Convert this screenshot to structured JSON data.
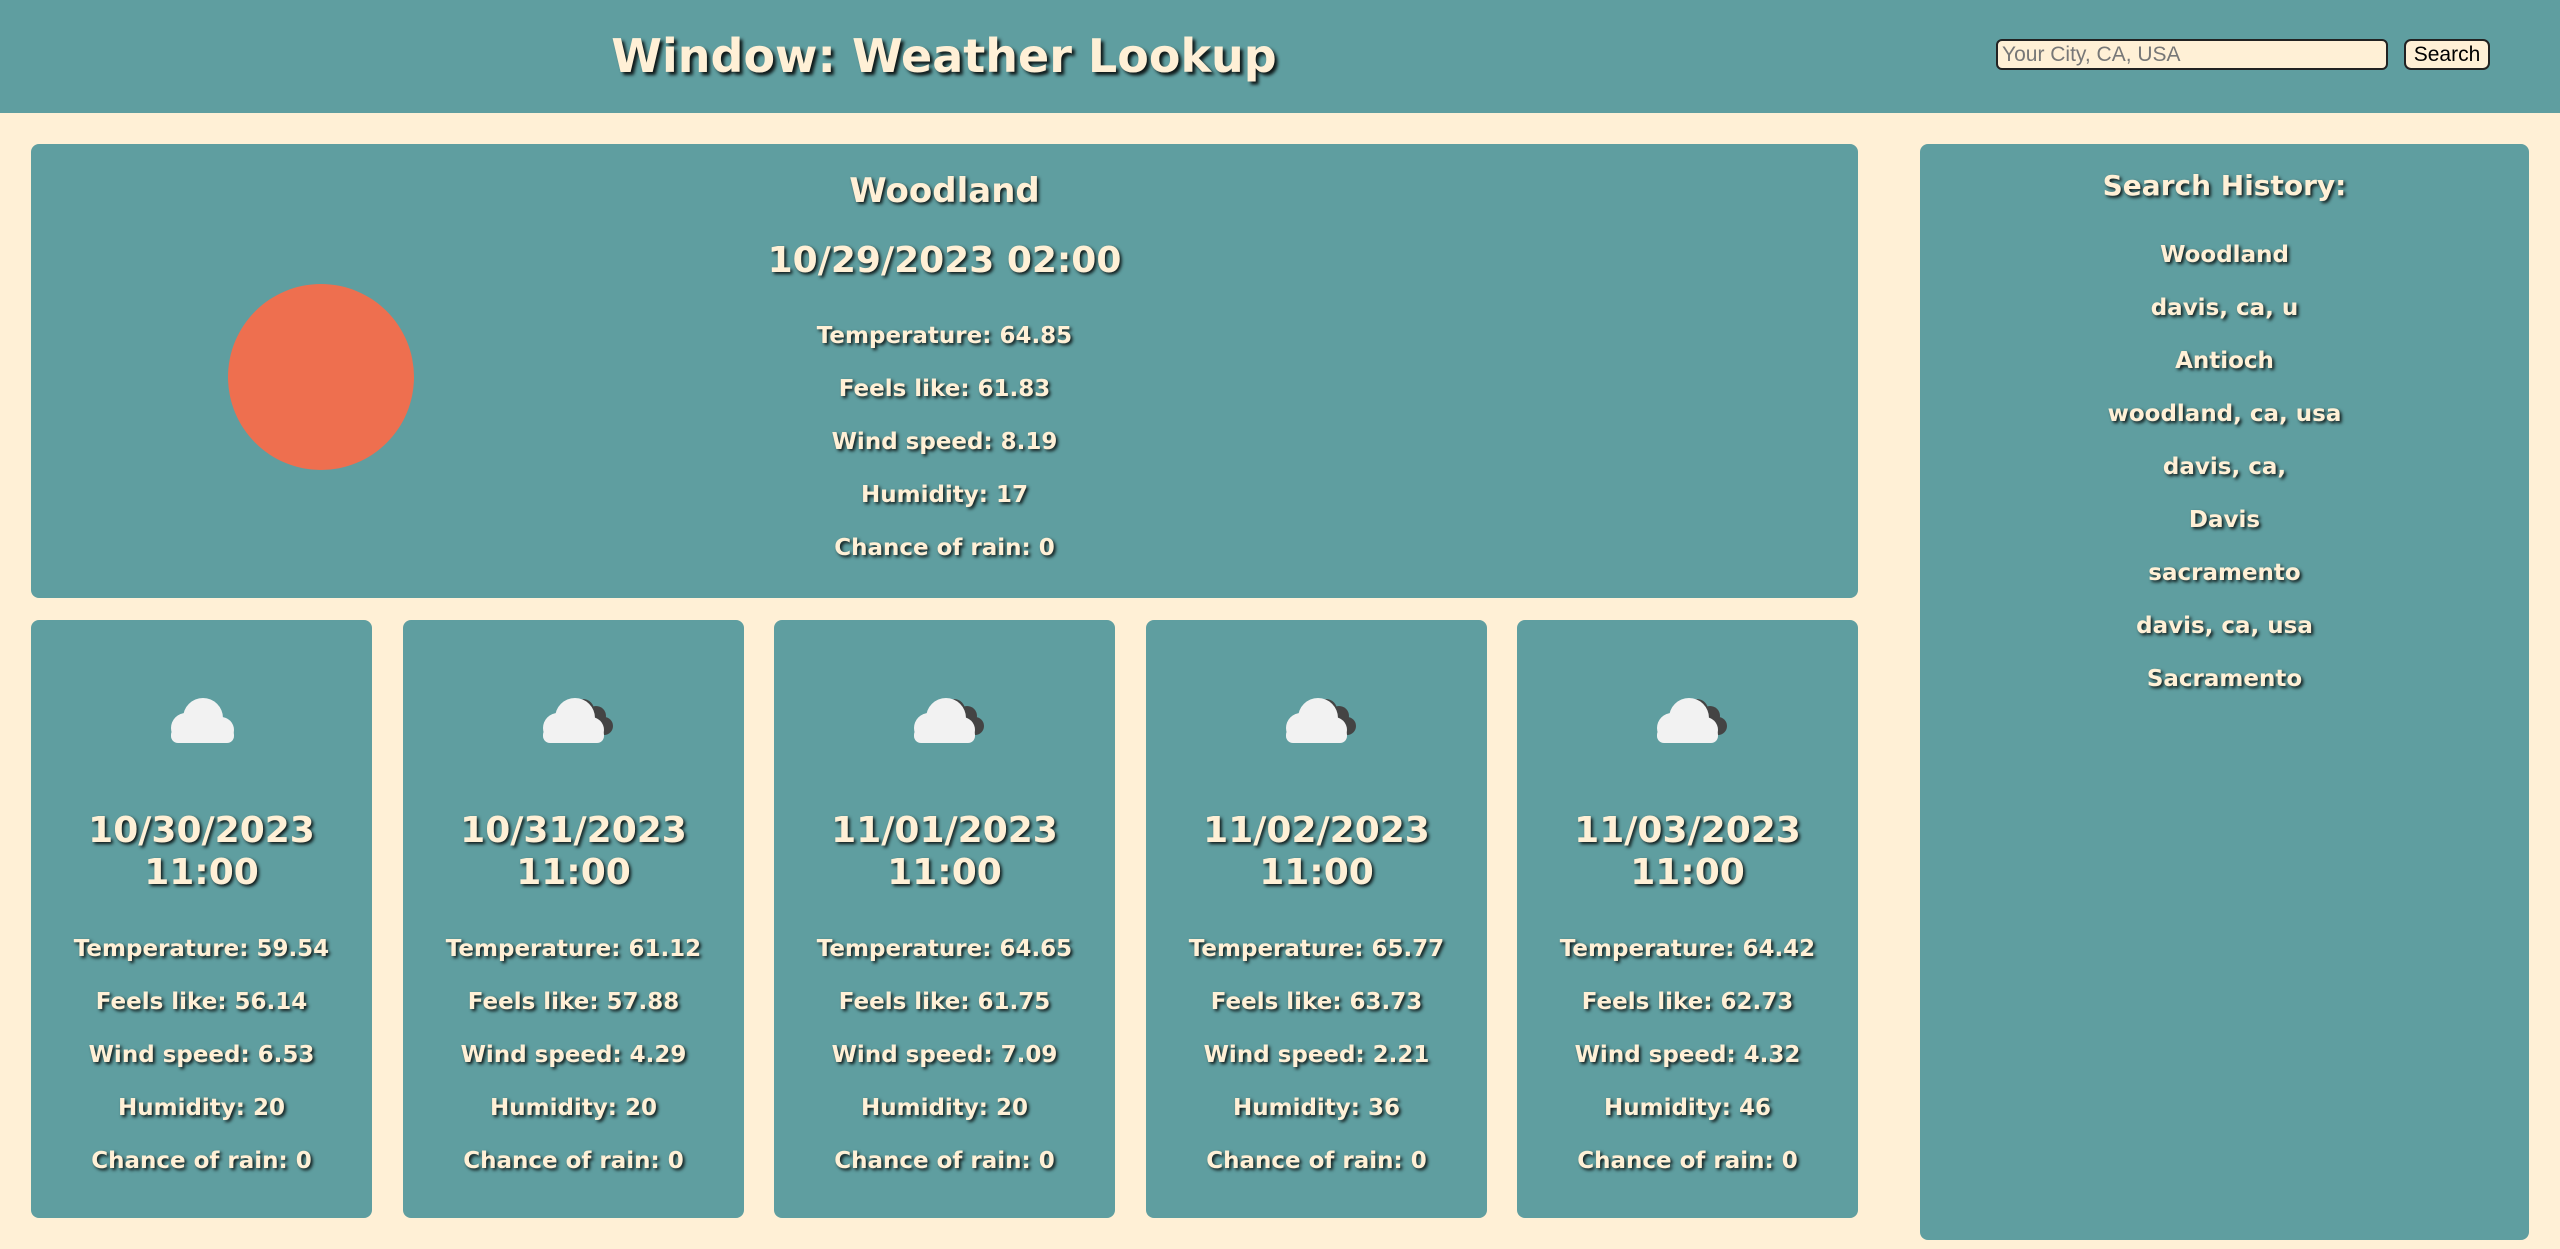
{
  "header": {
    "title": "Window: Weather Lookup",
    "search_placeholder": "Your City, CA, USA",
    "search_button": "Search"
  },
  "current": {
    "city": "Woodland",
    "datetime": "10/29/2023 02:00",
    "icon": "sun-icon",
    "temperature": "Temperature: 64.85",
    "feels_like": "Feels like: 61.83",
    "wind_speed": "Wind speed: 8.19",
    "humidity": "Humidity: 17",
    "chance_of_rain": "Chance of rain: 0"
  },
  "forecast": [
    {
      "date": "10/30/2023",
      "time": "11:00",
      "icon": "cloud-icon",
      "temperature": "Temperature: 59.54",
      "feels_like": "Feels like: 56.14",
      "wind_speed": "Wind speed: 6.53",
      "humidity": "Humidity: 20",
      "chance_of_rain": "Chance of rain: 0"
    },
    {
      "date": "10/31/2023",
      "time": "11:00",
      "icon": "clouds-icon",
      "temperature": "Temperature: 61.12",
      "feels_like": "Feels like: 57.88",
      "wind_speed": "Wind speed: 4.29",
      "humidity": "Humidity: 20",
      "chance_of_rain": "Chance of rain: 0"
    },
    {
      "date": "11/01/2023",
      "time": "11:00",
      "icon": "clouds-icon",
      "temperature": "Temperature: 64.65",
      "feels_like": "Feels like: 61.75",
      "wind_speed": "Wind speed: 7.09",
      "humidity": "Humidity: 20",
      "chance_of_rain": "Chance of rain: 0"
    },
    {
      "date": "11/02/2023",
      "time": "11:00",
      "icon": "clouds-icon",
      "temperature": "Temperature: 65.77",
      "feels_like": "Feels like: 63.73",
      "wind_speed": "Wind speed: 2.21",
      "humidity": "Humidity: 36",
      "chance_of_rain": "Chance of rain: 0"
    },
    {
      "date": "11/03/2023",
      "time": "11:00",
      "icon": "clouds-icon",
      "temperature": "Temperature: 64.42",
      "feels_like": "Feels like: 62.73",
      "wind_speed": "Wind speed: 4.32",
      "humidity": "Humidity: 46",
      "chance_of_rain": "Chance of rain: 0"
    }
  ],
  "history": {
    "title": "Search History:",
    "items": [
      "Woodland",
      "davis, ca, u",
      "Antioch",
      "woodland, ca, usa",
      "davis, ca,",
      "Davis",
      "sacramento",
      "davis, ca, usa",
      "Sacramento"
    ]
  },
  "colors": {
    "background": "#FFF0D6",
    "panel": "#5F9EA0",
    "text": "#FFF0D6",
    "sun": "#EE6F4F",
    "cloud_light": "#F2F2F2",
    "cloud_dark": "#444444"
  }
}
